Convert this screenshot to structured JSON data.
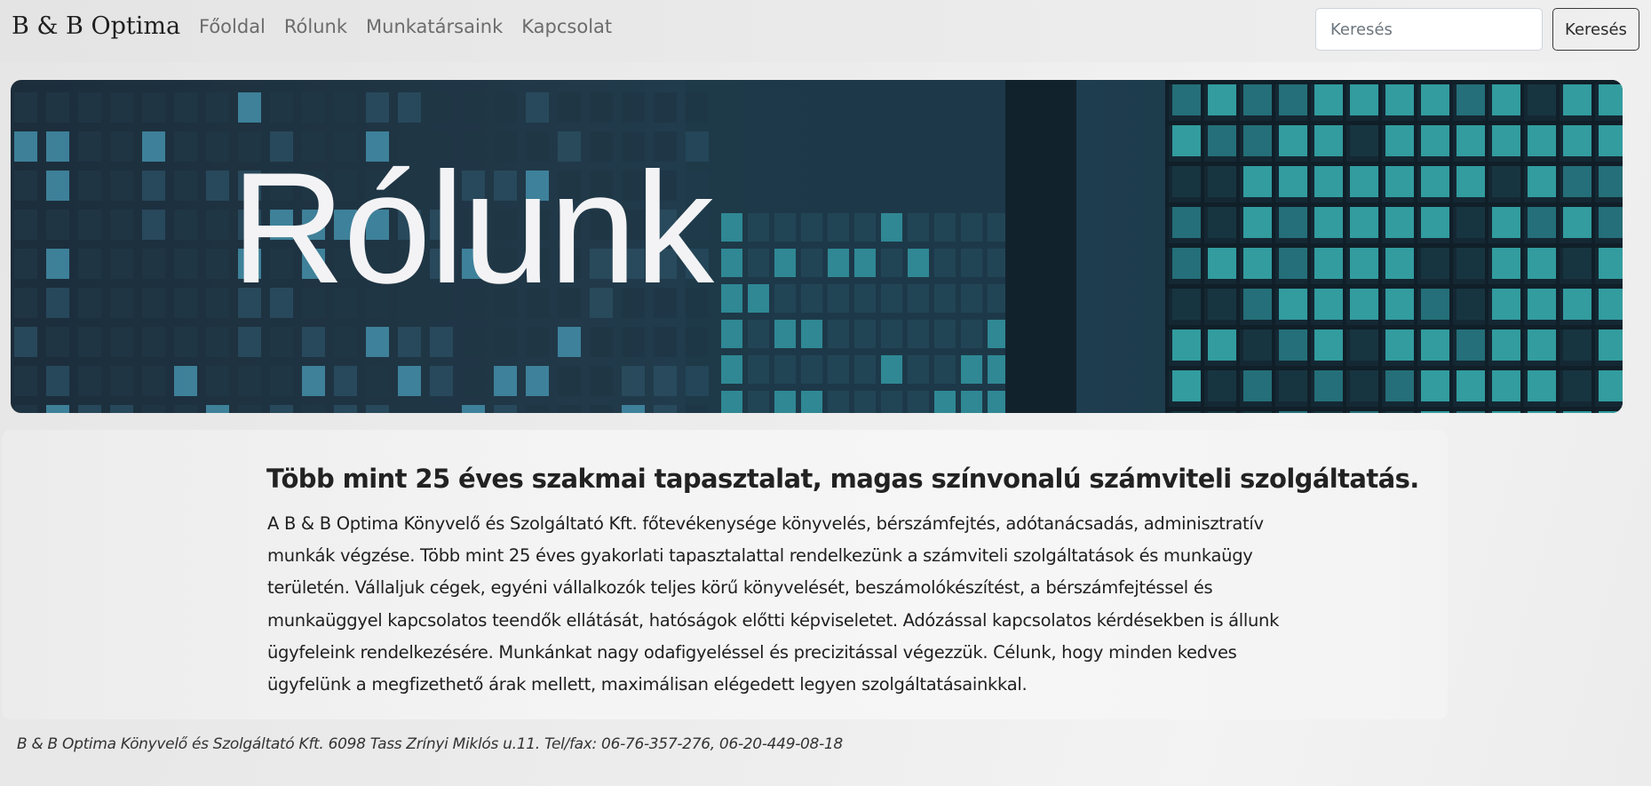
{
  "navbar": {
    "brand": "B & B Optima",
    "links": [
      "Főoldal",
      "Rólunk",
      "Munkatársaink",
      "Kapcsolat"
    ],
    "search_placeholder": "Keresés",
    "search_button": "Keresés"
  },
  "hero": {
    "title": "Rólunk"
  },
  "content": {
    "heading": "Több mint 25 éves szakmai tapasztalat, magas színvonalú számviteli szolgáltatás.",
    "lines": [
      "A B & B Optima Könyvelő és Szolgáltató Kft. főtevékenysége könyvelés, bérszámfejtés, adótanácsadás, adminisztratív",
      "munkák végzése. Több mint 25 éves gyakorlati tapasztalattal rendelkezünk a számviteli szolgáltatások és munkaügy",
      "területén. Vállaljuk cégek, egyéni vállalkozók teljes körű könyvelését, beszámolókészítést, a bérszámfejtéssel és",
      "munkaüggyel kapcsolatos teendők ellátását, hatóságok előtti képviseletet. Adózással kapcsolatos kérdésekben is állunk",
      "ügyfeleink rendelkezésére. Munkánkat nagy odafigyeléssel és precizitással végezzük. Célunk, hogy minden kedves",
      "ügyfelünk a megfizethető árak mellett, maximálisan elégedett legyen szolgáltatásainkkal."
    ]
  },
  "footer": {
    "text": "B & B Optima Könyvelő és Szolgáltató Kft. 6098 Tass Zrínyi Miklós u.11. Tel/fax: 06-76-357-276, 06-20-449-08-18"
  },
  "colors": {
    "hero_dark": "#1c2d3a",
    "hero_teal": "#3fc4c8",
    "text": "#212529",
    "nav_link": "#6c6c6c"
  }
}
